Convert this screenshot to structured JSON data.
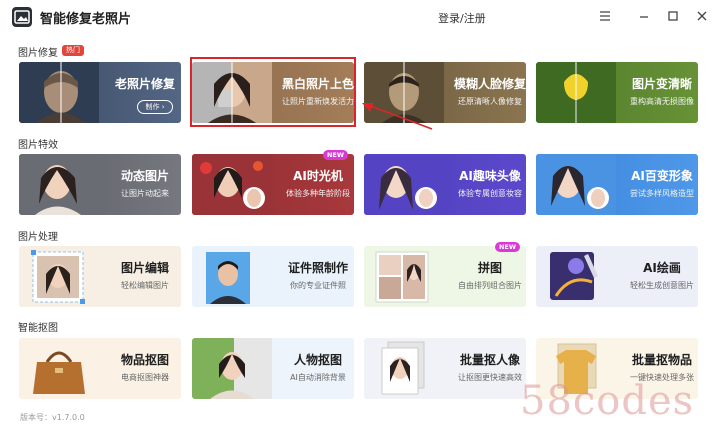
{
  "app": {
    "title": "智能修复老照片",
    "login": "登录/注册"
  },
  "sections": [
    {
      "label": "图片修复",
      "badge": "热门"
    },
    {
      "label": "图片特效"
    },
    {
      "label": "图片处理"
    },
    {
      "label": "智能抠图"
    }
  ],
  "cards": {
    "restore": [
      {
        "title": "老照片修复",
        "subtitle": "",
        "button": "制作 ›"
      },
      {
        "title": "黑白照片上色",
        "subtitle": "让照片重新焕发活力"
      },
      {
        "title": "模糊人脸修复",
        "subtitle": "还原清晰人像修复"
      },
      {
        "title": "图片变清晰",
        "subtitle": "重构高清无损图像"
      }
    ],
    "effects": [
      {
        "title": "动态图片",
        "subtitle": "让图片动起来"
      },
      {
        "title": "AI时光机",
        "subtitle": "体验多种年龄阶段",
        "badge": "NEW"
      },
      {
        "title": "AI趣味头像",
        "subtitle": "体验专属创意妆容"
      },
      {
        "title": "AI百变形象",
        "subtitle": "尝试多样风格造型"
      }
    ],
    "process": [
      {
        "title": "图片编辑",
        "subtitle": "轻松编辑图片"
      },
      {
        "title": "证件照制作",
        "subtitle": "你的专业证件照"
      },
      {
        "title": "拼图",
        "subtitle": "自由排列组合图片",
        "badge": "NEW"
      },
      {
        "title": "AI绘画",
        "subtitle": "轻松生成创意图片"
      }
    ],
    "cutout": [
      {
        "title": "物品抠图",
        "subtitle": "电商抠图神器"
      },
      {
        "title": "人物抠图",
        "subtitle": "AI自动消除背景"
      },
      {
        "title": "批量抠人像",
        "subtitle": "让抠图更快速高效"
      },
      {
        "title": "批量抠物品",
        "subtitle": "一键快速处理多张"
      }
    ]
  },
  "version": "版本号：v1.7.0.0",
  "watermark": "58codes",
  "colors": {
    "highlight": "#d8262a",
    "hot_badge": "#e2453c",
    "new_badge": "#d93ad6"
  }
}
